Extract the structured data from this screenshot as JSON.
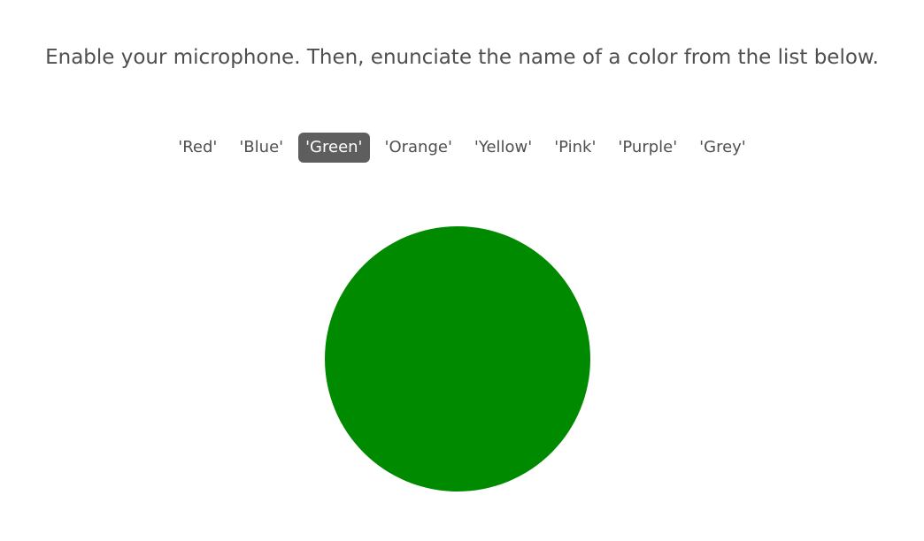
{
  "instructions": "Enable your microphone. Then, enunciate the name of a color from the list below.",
  "colors": {
    "options": [
      "'Red'",
      "'Blue'",
      "'Green'",
      "'Orange'",
      "'Yellow'",
      "'Pink'",
      "'Purple'",
      "'Grey'"
    ],
    "selected": "'Green'"
  },
  "circle": {
    "fill": "#008a00"
  }
}
